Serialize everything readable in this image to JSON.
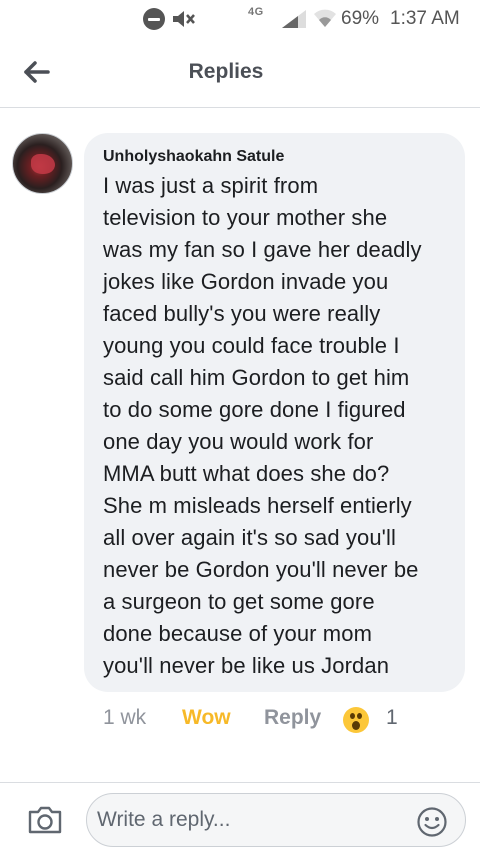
{
  "status_bar": {
    "network_type": "4G",
    "battery": "69%",
    "time": "1:37 AM",
    "icons": [
      "do-not-disturb-icon",
      "mute-icon",
      "signal-icon",
      "wifi-icon"
    ]
  },
  "header": {
    "title": "Replies",
    "back_icon": "arrow-left-icon"
  },
  "comment": {
    "author": "Unholyshaokahn Satule",
    "text": "I was just a spirit from\ntelevision to your mother she\nwas my fan so I gave her deadly\njokes like Gordon invade you\nfaced bully's you were really\nyoung you could face trouble I\nsaid call him Gordon to get him\nto do some gore done I figured\none day you would work for\nMMA butt what does she do?\nShe m misleads herself entierly\nall over again it's so sad you'll\nnever be Gordon you'll never be\na surgeon to get some gore\ndone because of your mom\nyou'll never be like us Jordan",
    "time_ago": "1 wk",
    "reaction_label": "Wow",
    "reply_label": "Reply",
    "reaction_icon": "wow-emoji-icon",
    "reaction_count": "1"
  },
  "composer": {
    "placeholder": "Write a reply...",
    "camera_icon": "camera-icon",
    "emoji_icon": "smiley-icon"
  },
  "colors": {
    "wow_accent": "#f7b928",
    "bubble_bg": "#f0f2f5",
    "muted_text": "#90949c"
  }
}
